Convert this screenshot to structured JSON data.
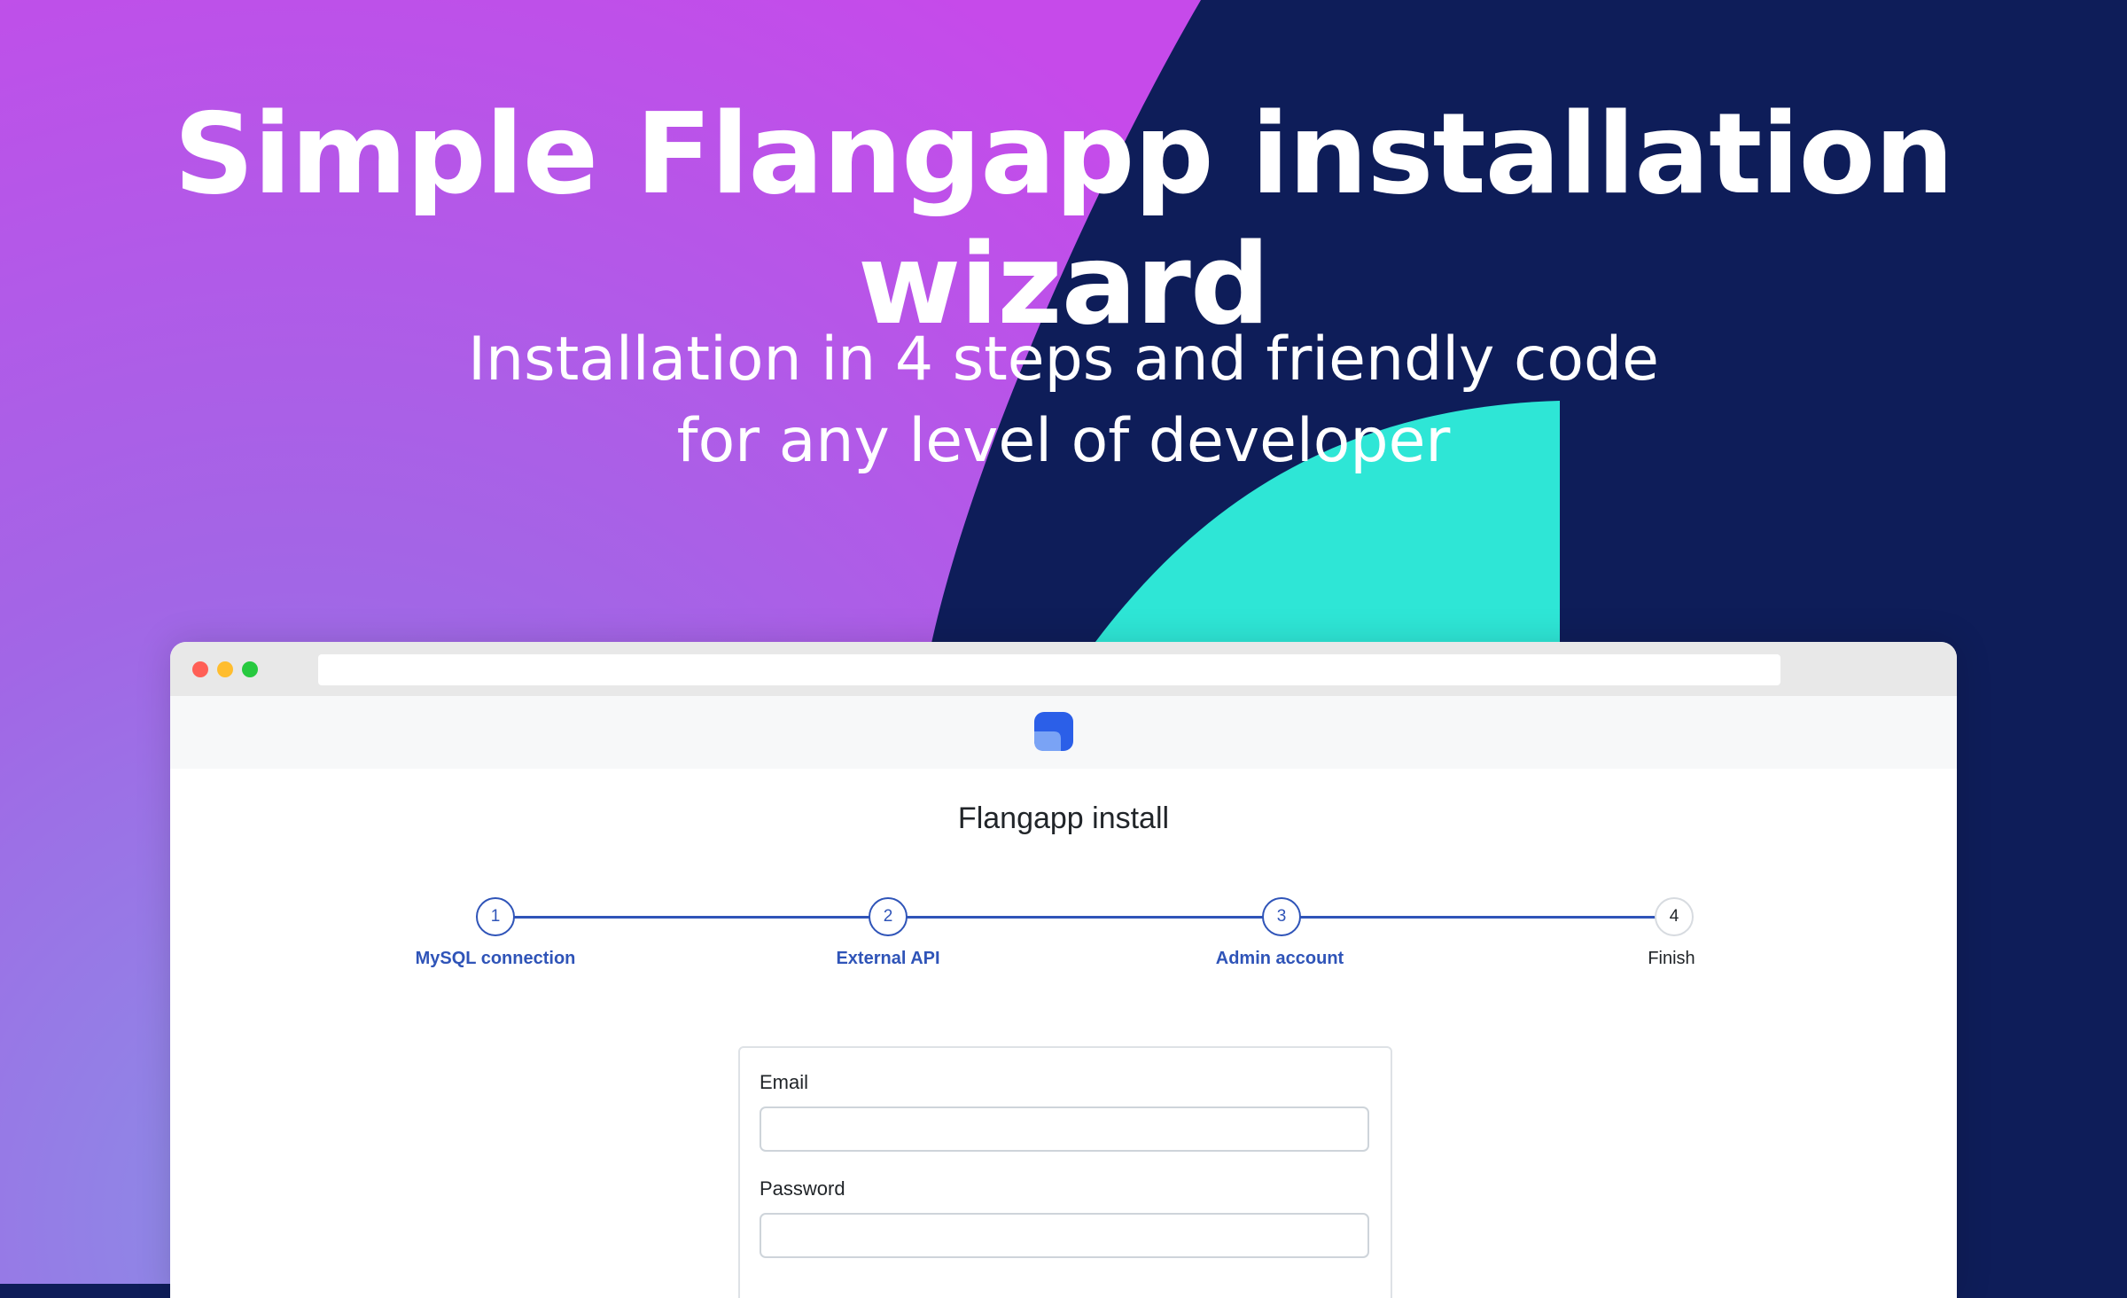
{
  "hero": {
    "title": "Simple Flangapp installation wizard",
    "subtitle_line1": "Installation in 4 steps and friendly code",
    "subtitle_line2": "for any level of developer"
  },
  "colors": {
    "navy": "#0e1d59",
    "gradient_purple": "#c148ea",
    "gradient_blue": "#8a8fe6",
    "teal": "#2ee6d6",
    "accent": "#2f54b8"
  },
  "browser": {
    "address_value": ""
  },
  "app": {
    "logo_icon": "flangapp-logo-icon",
    "install_title": "Flangapp install"
  },
  "wizard": {
    "steps": [
      {
        "number": "1",
        "label": "MySQL connection",
        "state": "complete"
      },
      {
        "number": "2",
        "label": "External API",
        "state": "complete"
      },
      {
        "number": "3",
        "label": "Admin account",
        "state": "active"
      },
      {
        "number": "4",
        "label": "Finish",
        "state": "pending"
      }
    ]
  },
  "form": {
    "email_label": "Email",
    "email_value": "",
    "password_label": "Password",
    "password_value": ""
  }
}
